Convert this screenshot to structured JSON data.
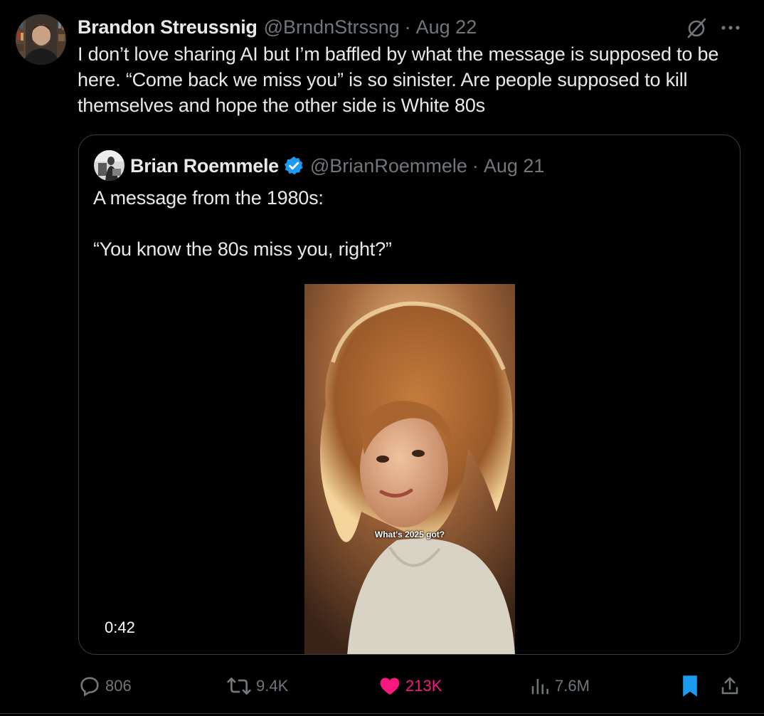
{
  "tweet": {
    "author_name": "Brandon Streussnig",
    "author_handle": "@BrndnStrssng",
    "separator": "·",
    "date": "Aug 22",
    "text": "I don’t love sharing AI but I’m baffled by what the message is supposed to be here. “Come back we miss you” is so sinister. Are people supposed to kill themselves and hope the other side is White 80s",
    "icons": {
      "avatar": "avatar",
      "grok": "grok-icon",
      "more": "more-icon"
    }
  },
  "quote": {
    "author_name": "Brian Roemmele",
    "verified_icon": "verified-badge-icon",
    "author_handle": "@BrianRoemmele",
    "separator": "·",
    "date": "Aug 21",
    "text_line_1": "A message from the 1980s:",
    "text_line_2": "“You know the 80s miss you, right?”",
    "video": {
      "caption": "What's 2025 got?",
      "duration": "0:42"
    }
  },
  "actions": {
    "replies": "806",
    "reposts": "9.4K",
    "likes": "213K",
    "views": "7.6M",
    "icons": [
      "reply-icon",
      "repost-icon",
      "like-icon",
      "views-icon",
      "bookmark-icon",
      "share-icon"
    ]
  },
  "colors": {
    "background": "#000000",
    "text": "#e7e9ea",
    "muted": "#71767b",
    "like": "#f91880",
    "verified": "#1d9bf0",
    "bookmark": "#1d9bf0",
    "border": "#2f3336"
  }
}
